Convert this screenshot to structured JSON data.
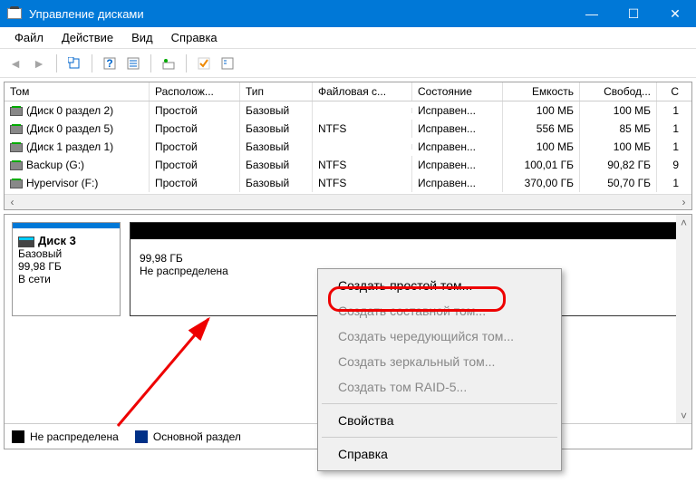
{
  "window": {
    "title": "Управление дисками"
  },
  "titlebar_buttons": {
    "minimize": "—",
    "maximize": "☐",
    "close": "✕"
  },
  "menu": {
    "file": "Файл",
    "action": "Действие",
    "view": "Вид",
    "help": "Справка"
  },
  "columns": {
    "volume": "Том",
    "layout": "Располож...",
    "type": "Тип",
    "fs": "Файловая с...",
    "status": "Состояние",
    "capacity": "Емкость",
    "free": "Свобод...",
    "pct": "С"
  },
  "rows": [
    {
      "name": "(Диск 0 раздел 2)",
      "layout": "Простой",
      "type": "Базовый",
      "fs": "",
      "status": "Исправен...",
      "cap": "100 МБ",
      "free": "100 МБ",
      "pct": "1"
    },
    {
      "name": "(Диск 0 раздел 5)",
      "layout": "Простой",
      "type": "Базовый",
      "fs": "NTFS",
      "status": "Исправен...",
      "cap": "556 МБ",
      "free": "85 МБ",
      "pct": "1"
    },
    {
      "name": "(Диск 1 раздел 1)",
      "layout": "Простой",
      "type": "Базовый",
      "fs": "",
      "status": "Исправен...",
      "cap": "100 МБ",
      "free": "100 МБ",
      "pct": "1"
    },
    {
      "name": "Backup (G:)",
      "layout": "Простой",
      "type": "Базовый",
      "fs": "NTFS",
      "status": "Исправен...",
      "cap": "100,01 ГБ",
      "free": "90,82 ГБ",
      "pct": "9"
    },
    {
      "name": "Hypervisor (F:)",
      "layout": "Простой",
      "type": "Базовый",
      "fs": "NTFS",
      "status": "Исправен...",
      "cap": "370,00 ГБ",
      "free": "50,70 ГБ",
      "pct": "1"
    }
  ],
  "disk": {
    "title": "Диск 3",
    "type": "Базовый",
    "size": "99,98 ГБ",
    "status": "В сети",
    "vol_size": "99,98 ГБ",
    "vol_status": "Не распределена"
  },
  "legend": {
    "unallocated": "Не распределена",
    "primary": "Основной раздел"
  },
  "ctx": {
    "simple": "Создать простой том...",
    "spanned": "Создать составной том...",
    "striped": "Создать чередующийся том...",
    "mirrored": "Создать зеркальный том...",
    "raid5": "Создать том RAID-5...",
    "props": "Свойства",
    "help": "Справка"
  }
}
